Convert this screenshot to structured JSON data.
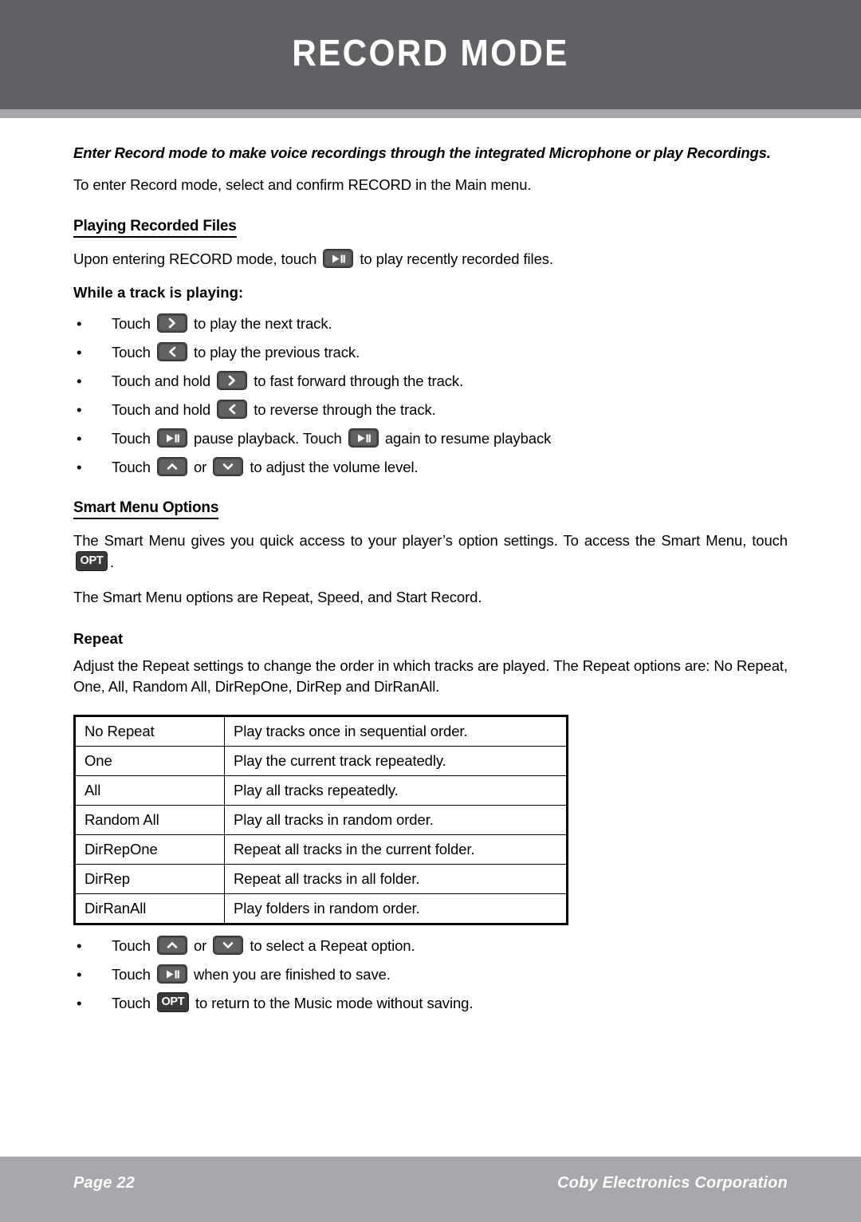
{
  "header": {
    "title": "RECORD MODE",
    "band_color": "#606164",
    "rule_color": "#a6a8ab"
  },
  "intro": {
    "bold_italic": "Enter Record mode to make voice recordings through the integrated Microphone or play Recordings.",
    "paragraph": "To enter Record mode, select and confirm RECORD in the Main menu."
  },
  "playing_recorded_files": {
    "heading": "Playing Recorded Files",
    "line_before_icon": "Upon entering RECORD mode, touch",
    "icon": "play-pause-icon",
    "line_after_icon": "to play recently recorded files.",
    "subheading": "While a track is playing:",
    "bullets": [
      {
        "pre": "Touch",
        "icon": "next-track-icon",
        "post": "to play the next track."
      },
      {
        "pre": "Touch",
        "icon": "previous-track-icon",
        "post": "to play the previous track."
      },
      {
        "pre": "Touch and hold",
        "icon": "fast-forward-icon",
        "post": "to fast forward through the track."
      },
      {
        "pre": "Touch and hold",
        "icon": "reverse-icon",
        "post": "to reverse through the track."
      },
      {
        "pre": "Touch",
        "icon": "play-pause-icon",
        "mid": "pause playback. Touch",
        "icon2": "play-pause-icon",
        "post": "again to resume playback"
      },
      {
        "pre": "Touch",
        "icon": "volume-up-icon",
        "mid": "or",
        "icon2": "volume-down-icon",
        "post": "to adjust the volume level."
      }
    ]
  },
  "smart_menu": {
    "heading": "Smart Menu Options",
    "para_before_icon": "The Smart Menu gives you quick access to your player’s option settings. To access the Smart Menu, touch",
    "icon": "opt-button-icon",
    "icon_label": "OPT",
    "para_after_icon": ".",
    "para2": "The Smart Menu options are Repeat, Speed, and Start Record."
  },
  "repeat": {
    "heading": "Repeat",
    "paragraph": "Adjust the Repeat settings to change the order in which tracks are played. The Repeat options are: No Repeat, One, All, Random All, DirRepOne, DirRep and DirRanAll.",
    "table": {
      "rows": [
        {
          "option": "No Repeat",
          "description": "Play tracks once in sequential order."
        },
        {
          "option": "One",
          "description": "Play the current track repeatedly."
        },
        {
          "option": "All",
          "description": "Play all tracks repeatedly."
        },
        {
          "option": "Random All",
          "description": "Play all tracks in random order."
        },
        {
          "option": "DirRepOne",
          "description": "Repeat all tracks in the current folder."
        },
        {
          "option": "DirRep",
          "description": "Repeat all tracks in all folder."
        },
        {
          "option": "DirRanAll",
          "description": "Play folders in random order."
        }
      ]
    },
    "bullets": [
      {
        "pre": "Touch",
        "icon": "volume-up-icon",
        "mid": "or",
        "icon2": "volume-down-icon",
        "post": "to select a Repeat option."
      },
      {
        "pre": "Touch",
        "icon": "play-pause-icon",
        "post": "when you are finished to save."
      },
      {
        "pre": "Touch",
        "icon": "opt-button-icon",
        "icon_label": "OPT",
        "post": "to return to the Music mode without saving."
      }
    ]
  },
  "footer": {
    "page": "Page 22",
    "corporation": "Coby Electronics Corporation",
    "band_color": "#a6a8ab"
  },
  "bullet_char": "•"
}
